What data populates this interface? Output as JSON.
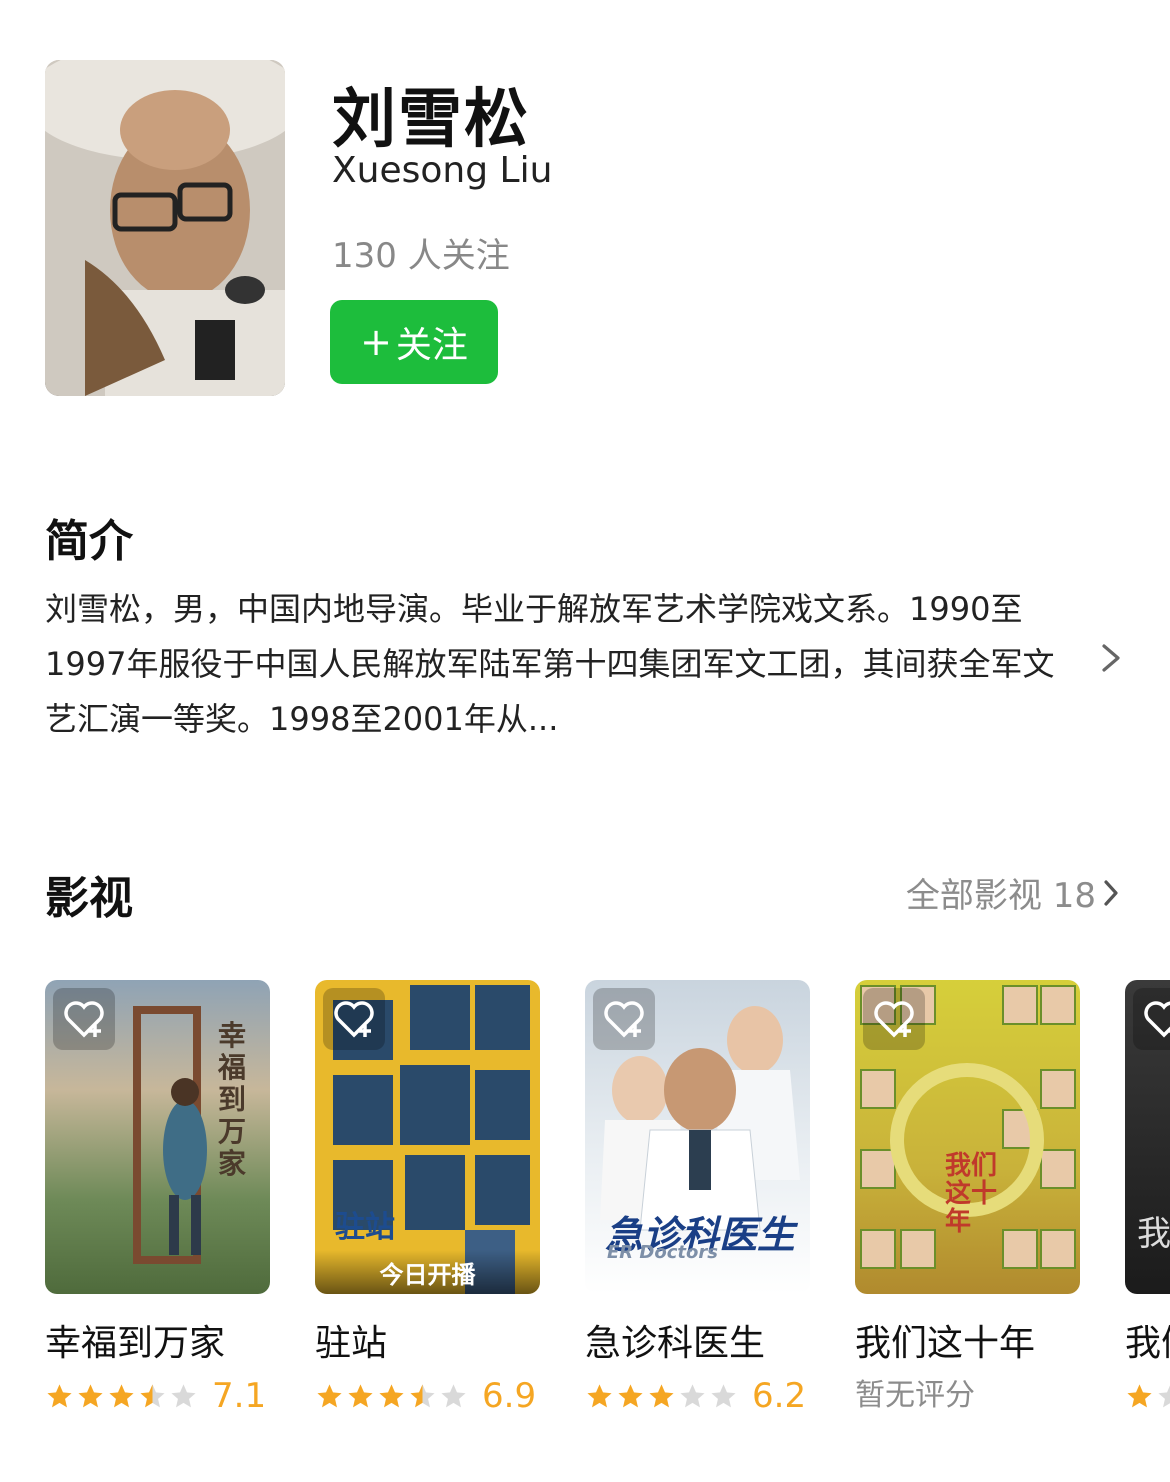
{
  "person": {
    "name_cn": "刘雪松",
    "name_en": "Xuesong Liu",
    "followers": "130 人关注",
    "follow_button": "关注",
    "follow_plus": "+"
  },
  "intro": {
    "title": "简介",
    "text": "刘雪松，男，中国内地导演。毕业于解放军艺术学院戏文系。1990至1997年服役于中国人民解放军陆军第十四集团军文工团，其间获全军文艺汇演一等奖。1998至2001年从..."
  },
  "media": {
    "title": "影视",
    "all_label": "全部影视 18",
    "items": [
      {
        "title": "幸福到万家",
        "rating": 7.1,
        "score_text": "7.1",
        "stars": 3.5,
        "poster_text": "幸福到万家"
      },
      {
        "title": "驻站",
        "rating": 6.9,
        "score_text": "6.9",
        "stars": 3.5,
        "poster_text": "驻站",
        "banner": "今日开播"
      },
      {
        "title": "急诊科医生",
        "rating": 6.2,
        "score_text": "6.2",
        "stars": 3,
        "poster_text": "急诊科医生",
        "poster_sub": "ER Doctors"
      },
      {
        "title": "我们这十年",
        "rating": null,
        "score_text": "暂无评分",
        "stars": 0,
        "poster_text": "我们这十年"
      },
      {
        "title": "我们",
        "rating": null,
        "score_text": "",
        "stars": 1,
        "poster_text": "我"
      }
    ]
  },
  "colors": {
    "follow_green": "#1dbd3c",
    "star_orange": "#f5a623",
    "star_gray": "#d9d9d9",
    "muted_text": "#8c8c8c"
  }
}
